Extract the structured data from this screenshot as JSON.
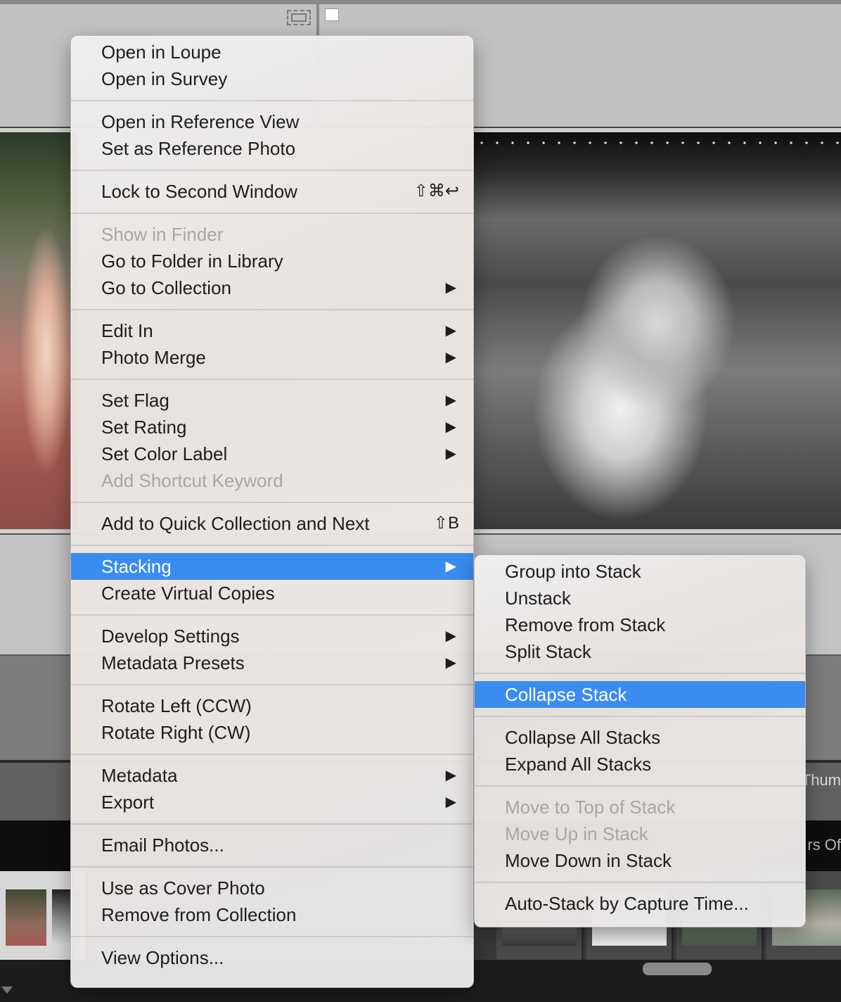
{
  "background": {
    "thumb_label": "Thum",
    "show_label": "rs Of"
  },
  "colors": {
    "selection": "#3b8cf0",
    "menu_text": "#1d1d1d",
    "disabled_text": "#a7a7a7"
  },
  "context_menu": {
    "groups": [
      [
        {
          "label": "Open in Loupe"
        },
        {
          "label": "Open in Survey"
        }
      ],
      [
        {
          "label": "Open in Reference View"
        },
        {
          "label": "Set as Reference Photo"
        }
      ],
      [
        {
          "label": "Lock to Second Window",
          "shortcut": "⇧⌘↩"
        }
      ],
      [
        {
          "label": "Show in Finder",
          "disabled": true
        },
        {
          "label": "Go to Folder in Library"
        },
        {
          "label": "Go to Collection",
          "submenu": true
        }
      ],
      [
        {
          "label": "Edit In",
          "submenu": true
        },
        {
          "label": "Photo Merge",
          "submenu": true
        }
      ],
      [
        {
          "label": "Set Flag",
          "submenu": true
        },
        {
          "label": "Set Rating",
          "submenu": true
        },
        {
          "label": "Set Color Label",
          "submenu": true
        },
        {
          "label": "Add Shortcut Keyword",
          "disabled": true
        }
      ],
      [
        {
          "label": "Add to Quick Collection and Next",
          "shortcut": "⇧B"
        }
      ],
      [
        {
          "label": "Stacking",
          "submenu": true,
          "selected": true
        },
        {
          "label": "Create Virtual Copies"
        }
      ],
      [
        {
          "label": "Develop Settings",
          "submenu": true
        },
        {
          "label": "Metadata Presets",
          "submenu": true
        }
      ],
      [
        {
          "label": "Rotate Left (CCW)"
        },
        {
          "label": "Rotate Right (CW)"
        }
      ],
      [
        {
          "label": "Metadata",
          "submenu": true
        },
        {
          "label": "Export",
          "submenu": true
        }
      ],
      [
        {
          "label": "Email Photos..."
        }
      ],
      [
        {
          "label": "Use as Cover Photo"
        },
        {
          "label": "Remove from Collection"
        }
      ],
      [
        {
          "label": "View Options..."
        }
      ]
    ]
  },
  "stacking_submenu": {
    "groups": [
      [
        {
          "label": "Group into Stack"
        },
        {
          "label": "Unstack"
        },
        {
          "label": "Remove from Stack"
        },
        {
          "label": "Split Stack"
        }
      ],
      [
        {
          "label": "Collapse Stack",
          "selected": true
        }
      ],
      [
        {
          "label": "Collapse All Stacks"
        },
        {
          "label": "Expand All Stacks"
        }
      ],
      [
        {
          "label": "Move to Top of Stack",
          "disabled": true
        },
        {
          "label": "Move Up in Stack",
          "disabled": true
        },
        {
          "label": "Move Down in Stack"
        }
      ],
      [
        {
          "label": "Auto-Stack by Capture Time..."
        }
      ]
    ]
  }
}
